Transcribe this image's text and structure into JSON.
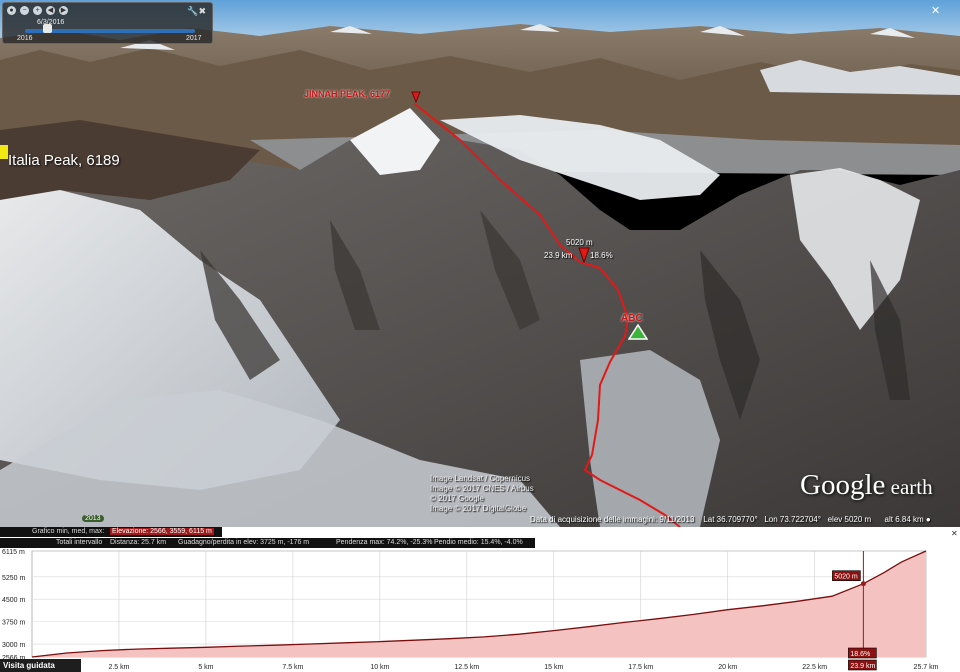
{
  "timeline": {
    "date": "6/3/2016",
    "start_year": "2016",
    "end_year": "2017",
    "slider_level": 0.13
  },
  "labels": {
    "jinnah_peak": "JINNAH PEAK, 6177",
    "italia_peak": "Italia Peak, 6189",
    "abc": "ABC",
    "marker_elev": "5020 m",
    "marker_dist": "23.9 km",
    "marker_slope": "18.6%"
  },
  "credits": [
    "Image Landsat / Copernicus",
    "Image © 2017 CNES / Airbus",
    "© 2017 Google",
    "Image © 2017 DigitalGlobe"
  ],
  "logo": {
    "main": "Google",
    "sub": " earth"
  },
  "year_chip": "2013",
  "status": {
    "acq_date": "Data di acquisizione delle immagini: 9/11/2013",
    "lat": "Lat   36.709770°",
    "lon": "Lon   73.722704°",
    "elev": "elev   5020 m",
    "alt": "alt   6.84 km"
  },
  "profile": {
    "row1": {
      "label": "Grafico  min, med, max:",
      "elevation": "Elevazione: 2566, 3559, 6115 m"
    },
    "row2": {
      "totals": "Totali intervallo",
      "distance": "Distanza: 25.7 km",
      "gain": "Guadagno/perdita in elev: 3725 m, -176 m",
      "slope_max": "Pendenza max: 74.2%, -25.3%",
      "slope_avg": "Pendio medio: 15.4%, -4.0%"
    },
    "visit_label": "Visita guidata",
    "popup_elev": "5020 m",
    "popup_slope": "18.6%",
    "popup_dist": "23.9 km"
  },
  "colors": {
    "route": "#e11919",
    "profile_fill": "#f4c2c0",
    "profile_line": "#7a0e0e",
    "highlight": "#9d1b1b"
  },
  "chart_data": {
    "type": "area",
    "xlabel": "",
    "ylabel": "",
    "ylim": [
      2566,
      6115
    ],
    "xlim": [
      0,
      25.7
    ],
    "y_ticks": [
      "6115 m",
      "5250 m",
      "4500 m",
      "3750 m",
      "3000 m",
      "2566 m"
    ],
    "y_tick_values": [
      6115,
      5250,
      4500,
      3750,
      3000,
      2566
    ],
    "x_ticks": [
      "2.5 km",
      "5 km",
      "7.5 km",
      "10 km",
      "12.5 km",
      "15 km",
      "17.5 km",
      "20 km",
      "22.5 km",
      "23.9 km",
      "25.7 km"
    ],
    "x_tick_values": [
      2.5,
      5,
      7.5,
      10,
      12.5,
      15,
      17.5,
      20,
      22.5,
      23.9,
      25.7
    ],
    "series": [
      {
        "x": [
          0,
          1,
          2,
          3,
          4,
          5,
          6,
          7,
          8,
          9,
          10,
          11,
          12,
          13,
          14,
          15,
          16,
          17,
          18,
          19,
          20,
          21,
          22,
          23,
          23.9,
          24.5,
          25,
          25.7
        ],
        "y": [
          2566,
          2700,
          2780,
          2830,
          2860,
          2890,
          2930,
          2960,
          3000,
          3040,
          3080,
          3130,
          3180,
          3240,
          3330,
          3450,
          3580,
          3720,
          3850,
          3990,
          4150,
          4280,
          4430,
          4600,
          5020,
          5400,
          5750,
          6115
        ]
      }
    ],
    "grid": true
  }
}
